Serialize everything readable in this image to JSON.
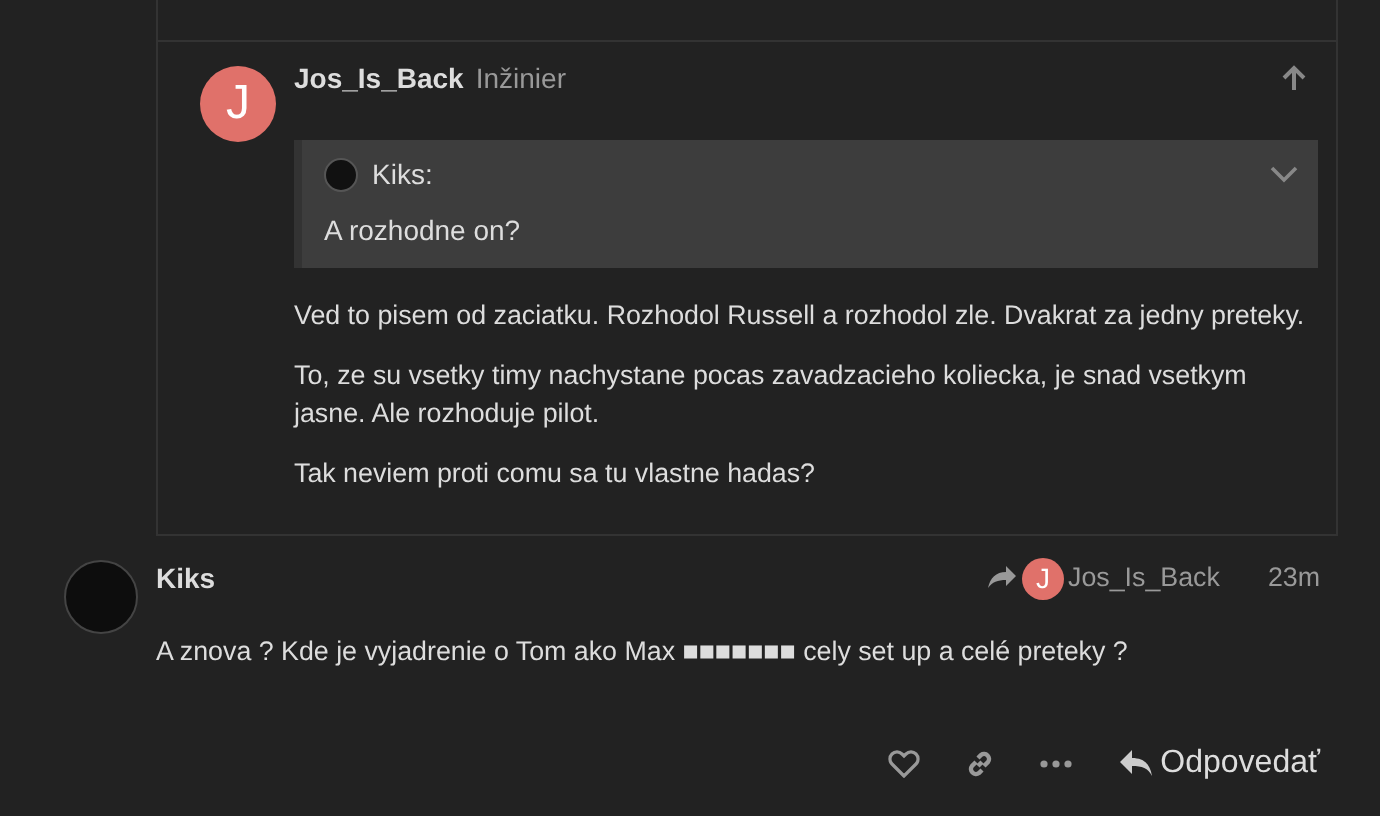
{
  "embedded_post": {
    "author": {
      "initial": "J",
      "name": "Jos_Is_Back",
      "title": "Inžinier"
    },
    "quote": {
      "author": "Kiks:",
      "text": "A rozhodne on?",
      "expanded": false
    },
    "paragraphs": [
      "Ved to pisem od zaciatku. Rozhodol Russell a rozhodol zle. Dvakrat za jedny preteky.",
      "To, ze su vsetky timy nachystane pocas zavadzacieho koliecka, je snad vsetkym jasne. Ale rozhoduje pilot.",
      "Tak neviem proti comu sa tu vlastne hadas?"
    ]
  },
  "post": {
    "author": "Kiks",
    "reply_to": {
      "initial": "J",
      "name": "Jos_Is_Back"
    },
    "time": "23m",
    "text": "A znova ? Kde je vyjadrenie o Tom ako Max ■■■■■■■ cely set up a celé preteky ?",
    "actions": {
      "reply": "Odpovedať"
    }
  }
}
